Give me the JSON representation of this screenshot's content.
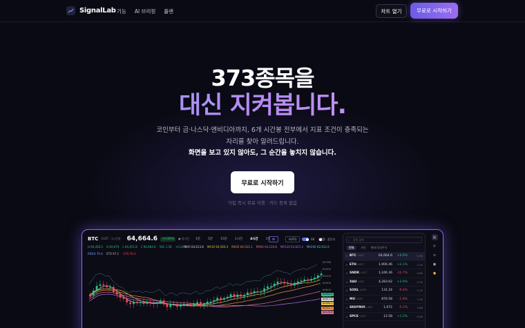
{
  "nav": {
    "brand": "SignalLab",
    "links": [
      "기능",
      "AI 브리핑",
      "플랜"
    ],
    "chart_button": "차트 열기",
    "free_button": "무료로 시작하기"
  },
  "hero": {
    "title_line1": "373종목을",
    "title_line2": "대신 지켜봅니다.",
    "subtitle_line1": "코인부터 금·나스닥·엔비디아까지, 6개 시간봉 전부에서 지표 조건이 충족되는",
    "subtitle_line2": "자리를 찾아 알려드립니다.",
    "subtitle_line3": "화면을 보고 있지 않아도, 그 순간을 놓치지 않습니다.",
    "cta": "무료로 시작하기",
    "note": "가입 즉시 무료 이용 · 카드 등록 없음"
  },
  "preview": {
    "symbol": "BTC",
    "pair": "USDT · 1시간봉",
    "price": "64,664.6",
    "change": "+0.89%",
    "live": "실시간",
    "timeframes": [
      "1분",
      "5분",
      "15분",
      "1시간",
      "4시간",
      "1일"
    ],
    "active_timeframe": "1시간",
    "ai_label": "AI",
    "auto_label": "AUTO",
    "toggle1_label": "BB",
    "toggle2_label": "볼린저",
    "ohlc": [
      "H 64,456.2",
      "H 64,679",
      "L 64,451.8",
      "C 64,664.6",
      "VOL 1.5K",
      "+0.28%"
    ],
    "ma_labels": [
      {
        "text": "MA5 64,613.8",
        "color": "#d6d6d6"
      },
      {
        "text": "MA10 64,560.3",
        "color": "#e2c04a"
      },
      {
        "text": "MA20 64,522.1",
        "color": "#f0923c"
      },
      {
        "text": "MA60 64,126.8",
        "color": "#e06c8f"
      },
      {
        "text": "MA120 63,825.4",
        "color": "#a773e8"
      },
      {
        "text": "MA200 62,612.6",
        "color": "#5ec4d6"
      }
    ],
    "rsi_labels": [
      {
        "text": "RSI14 70.4",
        "color": "#6ea8ff"
      },
      {
        "text": "STO 97.2",
        "color": "#b9b9b9"
      },
      {
        "text": "-270.76.4",
        "color": "#ef4b55"
      }
    ],
    "y_ticks": [
      "65768",
      "65500",
      "65200",
      "64900",
      "64600",
      "64300",
      "64000",
      "63700"
    ],
    "price_tags": [
      {
        "text": "64664.6",
        "color": "#26c281"
      },
      {
        "text": "64613.8",
        "color": "#d6d6d6"
      },
      {
        "text": "64560.3",
        "color": "#e2c04a"
      },
      {
        "text": "64522.1",
        "color": "#f0923c"
      },
      {
        "text": "64126.8",
        "color": "#e06c8f"
      }
    ],
    "search_placeholder": "종목 검색",
    "panel_tabs": [
      "전체",
      "코인",
      "해외/국내주식"
    ],
    "rows": [
      {
        "name": "BTC",
        "sub": "USDT",
        "price": "64,664.6",
        "change": "+0.9%",
        "vol": "1.5K",
        "up": true
      },
      {
        "name": "ETH",
        "sub": "USDT",
        "price": "1,906.46",
        "change": "+2.1%",
        "vol": "2.1K",
        "up": true
      },
      {
        "name": "SNDK",
        "sub": "USDT",
        "price": "1,246.36",
        "change": "-12.7%",
        "vol": "0.8K",
        "up": false
      },
      {
        "name": "XAU",
        "sub": "USDT",
        "price": "4,283.62",
        "change": "+2.9%",
        "vol": "2.7K",
        "up": true
      },
      {
        "name": "SOXL",
        "sub": "USDT",
        "price": "131.24",
        "change": "-9.4%",
        "vol": "2.1K",
        "up": false
      },
      {
        "name": "MU",
        "sub": "USDT",
        "price": "876.58",
        "change": "-1.8%",
        "vol": "1.2K",
        "up": false
      },
      {
        "name": "SKHYNIX",
        "sub": "USDT",
        "price": "1,072",
        "change": "-5.1%",
        "vol": "1.8K",
        "up": false
      },
      {
        "name": "SPCE",
        "sub": "USDT",
        "price": "12.58",
        "change": "+1.2%",
        "vol": "0.9K",
        "up": true
      }
    ]
  }
}
